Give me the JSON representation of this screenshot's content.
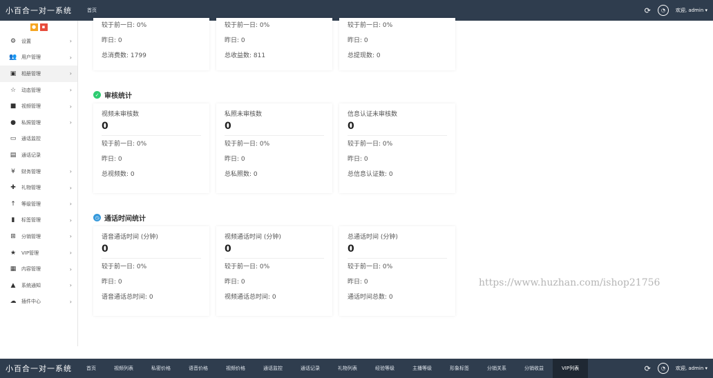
{
  "app_title": "小百合一对一系统",
  "header": {
    "tabs": [
      "首页"
    ],
    "refresh_icon": "refresh-icon",
    "user_greeting": "欢迎, admin ▾"
  },
  "footer_bar": {
    "tabs": [
      "首页",
      "视频列表",
      "私密价格",
      "语音价格",
      "视频价格",
      "通话监控",
      "通话记录",
      "礼物列表",
      "经验等级",
      "主播等级",
      "形象标签",
      "分销关系",
      "分销收益",
      "VIP列表"
    ],
    "active_tab": "VIP列表",
    "user_greeting": "欢迎, admin ▾"
  },
  "sidebar": {
    "items": [
      {
        "label": "设置",
        "icon": "gear-icon",
        "glyph": "⚙",
        "arrow": true
      },
      {
        "label": "用户管理",
        "icon": "users-icon",
        "glyph": "👥",
        "arrow": true
      },
      {
        "label": "相册管理",
        "icon": "image-icon",
        "glyph": "▣",
        "arrow": true,
        "active": true
      },
      {
        "label": "动态管理",
        "icon": "star-outline-icon",
        "glyph": "☆",
        "arrow": true
      },
      {
        "label": "视频管理",
        "icon": "video-icon",
        "glyph": "■",
        "arrow": true
      },
      {
        "label": "私照管理",
        "icon": "circle-play-icon",
        "glyph": "●",
        "arrow": true
      },
      {
        "label": "通话监控",
        "icon": "monitor-icon",
        "glyph": "▭",
        "arrow": false
      },
      {
        "label": "通话记录",
        "icon": "keyboard-icon",
        "glyph": "▤",
        "arrow": false
      },
      {
        "label": "财务管理",
        "icon": "yen-icon",
        "glyph": "¥",
        "arrow": true
      },
      {
        "label": "礼物管理",
        "icon": "gift-icon",
        "glyph": "✚",
        "arrow": true
      },
      {
        "label": "等级管理",
        "icon": "level-up-icon",
        "glyph": "↑",
        "arrow": true
      },
      {
        "label": "标签管理",
        "icon": "bookmark-icon",
        "glyph": "▮",
        "arrow": true
      },
      {
        "label": "分销管理",
        "icon": "sitemap-icon",
        "glyph": "⊞",
        "arrow": true
      },
      {
        "label": "VIP管理",
        "icon": "star-icon",
        "glyph": "★",
        "arrow": true
      },
      {
        "label": "内容管理",
        "icon": "grid-icon",
        "glyph": "▦",
        "arrow": true
      },
      {
        "label": "系统通知",
        "icon": "bell-icon",
        "glyph": "▲",
        "arrow": true
      },
      {
        "label": "插件中心",
        "icon": "cloud-icon",
        "glyph": "☁",
        "arrow": true
      }
    ]
  },
  "top_partial_cards": [
    {
      "compare": "较于前一日: 0%",
      "yesterday": "昨日: 0",
      "total": "总消费数: 1799"
    },
    {
      "compare": "较于前一日: 0%",
      "yesterday": "昨日: 0",
      "total": "总收益数: 811"
    },
    {
      "compare": "较于前一日: 0%",
      "yesterday": "昨日: 0",
      "total": "总提现数: 0"
    }
  ],
  "sections": [
    {
      "title": "审核统计",
      "icon": "shield-check-icon",
      "color": "#2ecc71",
      "cards": [
        {
          "label": "视频未审核数",
          "value": "0",
          "compare": "较于前一日: 0%",
          "yesterday": "昨日: 0",
          "total": "总视频数: 0"
        },
        {
          "label": "私照未审核数",
          "value": "0",
          "compare": "较于前一日: 0%",
          "yesterday": "昨日: 0",
          "total": "总私照数: 0"
        },
        {
          "label": "信息认证未审核数",
          "value": "0",
          "compare": "较于前一日: 0%",
          "yesterday": "昨日: 0",
          "total": "总信息认证数: 0"
        }
      ]
    },
    {
      "title": "通话时间统计",
      "icon": "clock-icon",
      "color": "#3498db",
      "cards": [
        {
          "label": "语音通话时间 (分钟)",
          "value": "0",
          "compare": "较于前一日: 0%",
          "yesterday": "昨日: 0",
          "total": "语音通话总时间: 0"
        },
        {
          "label": "视频通话时间 (分钟)",
          "value": "0",
          "compare": "较于前一日: 0%",
          "yesterday": "昨日: 0",
          "total": "视频通话总时间: 0"
        },
        {
          "label": "总通话时间 (分钟)",
          "value": "0",
          "compare": "较于前一日: 0%",
          "yesterday": "昨日: 0",
          "total": "通话时间总数: 0"
        }
      ]
    }
  ],
  "watermark": "https://www.huzhan.com/ishop21756"
}
